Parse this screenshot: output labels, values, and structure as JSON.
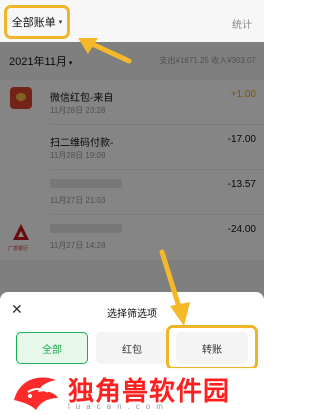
{
  "header": {
    "filter_label": "全部账单",
    "stats_label": "统计"
  },
  "month": {
    "label": "2021年11月",
    "summary": "支出¥1671.25 收入¥303.07"
  },
  "transactions": [
    {
      "title": "微信红包-来自",
      "time": "11月28日 23:28",
      "amount": "+1.00"
    },
    {
      "title": "扫二维码付款-",
      "time": "11月28日 19:09",
      "amount": "-17.00"
    },
    {
      "title": "",
      "time": "11月27日 21:03",
      "amount": "-13.57"
    },
    {
      "title": "",
      "time": "11月27日 14:28",
      "amount": "-24.00",
      "bank": "广发银行"
    }
  ],
  "sheet": {
    "title": "选择筛选项",
    "chips": [
      "全部",
      "红包",
      "转账"
    ]
  },
  "watermark": {
    "title": "独角兽软件园",
    "url": "luacan.com"
  },
  "colors": {
    "highlight": "#f0b429",
    "accent_green": "#1aad52",
    "income": "#f0a500"
  }
}
